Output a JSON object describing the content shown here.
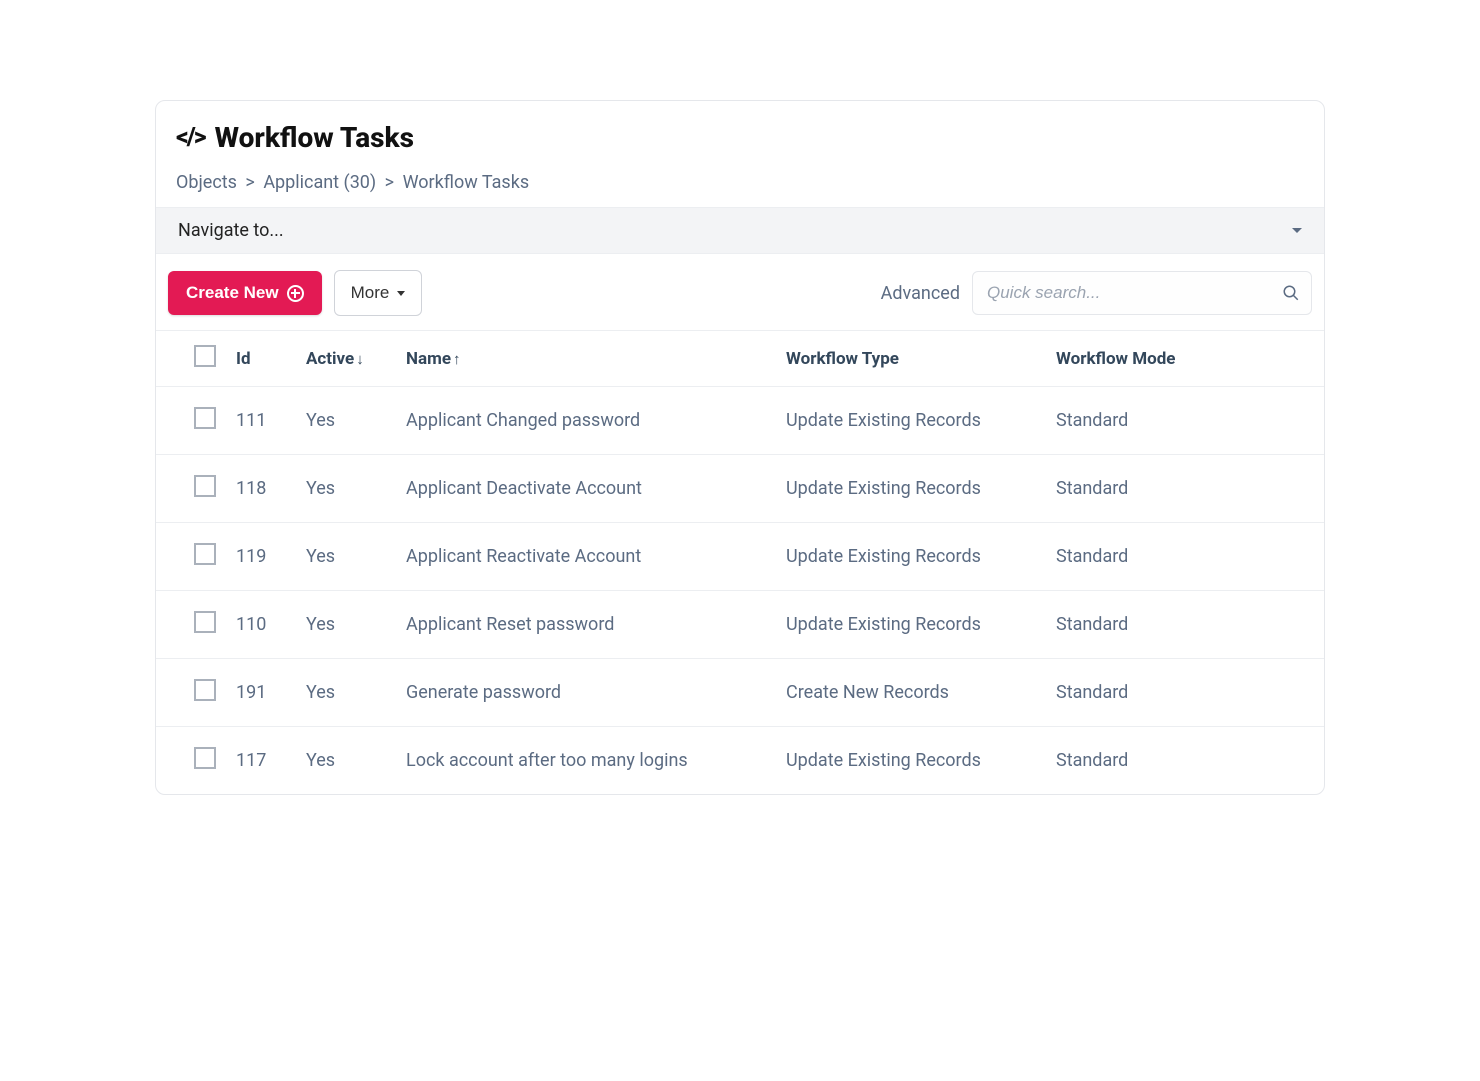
{
  "title": "Workflow Tasks",
  "breadcrumb": {
    "items": [
      "Objects",
      "Applicant (30)",
      "Workflow Tasks"
    ]
  },
  "nav_placeholder": "Navigate to...",
  "toolbar": {
    "create_label": "Create New",
    "more_label": "More",
    "advanced_label": "Advanced",
    "search_placeholder": "Quick search..."
  },
  "table": {
    "headers": {
      "id": "Id",
      "active": "Active",
      "name": "Name",
      "type": "Workflow Type",
      "mode": "Workflow Mode"
    },
    "sort_indicator_active": "↓",
    "sort_indicator_name": "↑",
    "rows": [
      {
        "id": "111",
        "active": "Yes",
        "name": "Applicant Changed password",
        "type": "Update Existing Records",
        "mode": "Standard"
      },
      {
        "id": "118",
        "active": "Yes",
        "name": "Applicant Deactivate Account",
        "type": "Update Existing Records",
        "mode": "Standard"
      },
      {
        "id": "119",
        "active": "Yes",
        "name": "Applicant Reactivate Account",
        "type": "Update Existing Records",
        "mode": "Standard"
      },
      {
        "id": "110",
        "active": "Yes",
        "name": "Applicant Reset password",
        "type": "Update Existing Records",
        "mode": "Standard"
      },
      {
        "id": "191",
        "active": "Yes",
        "name": "Generate password",
        "type": "Create New Records",
        "mode": "Standard"
      },
      {
        "id": "117",
        "active": "Yes",
        "name": "Lock account after too many logins",
        "type": "Update Existing Records",
        "mode": "Standard"
      }
    ]
  }
}
